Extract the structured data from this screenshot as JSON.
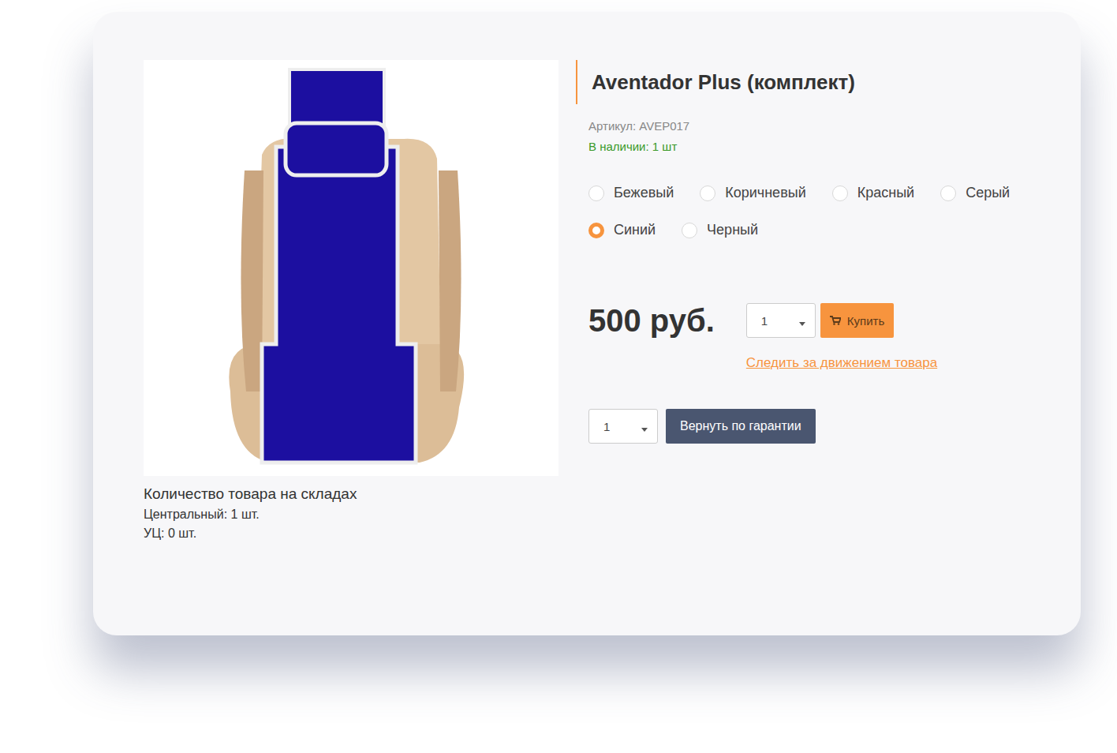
{
  "product": {
    "title": "Aventador Plus (комплект)",
    "sku": "Артикул: AVEP017",
    "availability": "В наличии: 1 шт"
  },
  "colors": [
    {
      "label": "Бежевый",
      "selected": false
    },
    {
      "label": "Коричневый",
      "selected": false
    },
    {
      "label": "Красный",
      "selected": false
    },
    {
      "label": "Серый",
      "selected": false
    },
    {
      "label": "Синий",
      "selected": true
    },
    {
      "label": "Черный",
      "selected": false
    }
  ],
  "price": "500 руб.",
  "buy": {
    "quantity": "1",
    "button": "Купить"
  },
  "track_link": "Следить за движением товара",
  "warranty": {
    "quantity": "1",
    "button": "Вернуть по гарантии"
  },
  "stock": {
    "title": "Количество товара на складах",
    "warehouses": [
      {
        "label": "Центральный: 1 шт."
      },
      {
        "label": "УЦ: 0 шт."
      }
    ]
  }
}
